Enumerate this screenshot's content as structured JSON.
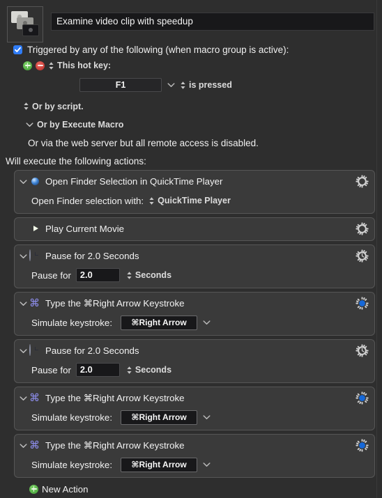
{
  "macro": {
    "icon_name": "stacked-screens-thumbnail",
    "title": "Examine video clip with speedup"
  },
  "trigger": {
    "checkbox_checked": true,
    "label": "Triggered by any of the following (when macro group is active):",
    "add_button_label": "+",
    "remove_button_label": "−",
    "hotkey_label": "This hot key:",
    "hotkey_value": "F1",
    "hotkey_condition": "is pressed",
    "or_by_script": "Or by script.",
    "or_by_execute_macro": "Or by Execute Macro",
    "web_server_note": "Or via the web server but all remote access is disabled."
  },
  "actions_header": "Will execute the following actions:",
  "actions": [
    {
      "icon": "quicktime-icon",
      "title": "Open Finder Selection in QuickTime Player",
      "has_disclosure": true,
      "gear": "gear-plain",
      "body": {
        "type": "popup",
        "label": "Open Finder selection with:",
        "value": "QuickTime Player"
      }
    },
    {
      "icon": "play-icon",
      "title": "Play Current Movie",
      "has_disclosure": false,
      "gear": "gear-plain",
      "body": null
    },
    {
      "icon": "clock-icon",
      "title": "Pause for 2.0 Seconds",
      "has_disclosure": true,
      "gear": "gear-clock",
      "body": {
        "type": "pause",
        "label": "Pause for",
        "value": "2.0",
        "units": "Seconds"
      }
    },
    {
      "icon": "command-icon",
      "title": "Type the ⌘Right Arrow Keystroke",
      "has_disclosure": true,
      "gear": "gear-blue",
      "body": {
        "type": "keystroke",
        "label": "Simulate keystroke:",
        "value": "⌘Right Arrow"
      }
    },
    {
      "icon": "clock-icon",
      "title": "Pause for 2.0 Seconds",
      "has_disclosure": true,
      "gear": "gear-clock",
      "body": {
        "type": "pause",
        "label": "Pause for",
        "value": "2.0",
        "units": "Seconds"
      }
    },
    {
      "icon": "command-icon",
      "title": "Type the ⌘Right Arrow Keystroke",
      "has_disclosure": true,
      "gear": "gear-blue",
      "body": {
        "type": "keystroke",
        "label": "Simulate keystroke:",
        "value": "⌘Right Arrow"
      }
    },
    {
      "icon": "command-icon",
      "title": "Type the ⌘Right Arrow Keystroke",
      "has_disclosure": true,
      "gear": "gear-blue",
      "body": {
        "type": "keystroke",
        "label": "Simulate keystroke:",
        "value": "⌘Right Arrow"
      }
    }
  ],
  "new_action": {
    "label": "New Action",
    "icon": "plus-circle-icon"
  },
  "colors": {
    "window_bg": "#2e2e2e",
    "action_bg": "#3a3a3a",
    "action_border": "#565656",
    "accent_blue": "#2f7cf6",
    "gear_blue": "#1668d8",
    "green": "#4d9a18",
    "red": "#bb2b25",
    "command_purple": "#8f8ff0",
    "field_bg": "#18181a",
    "text": "#f0f0f0",
    "text_dim": "#dcdcdc"
  }
}
